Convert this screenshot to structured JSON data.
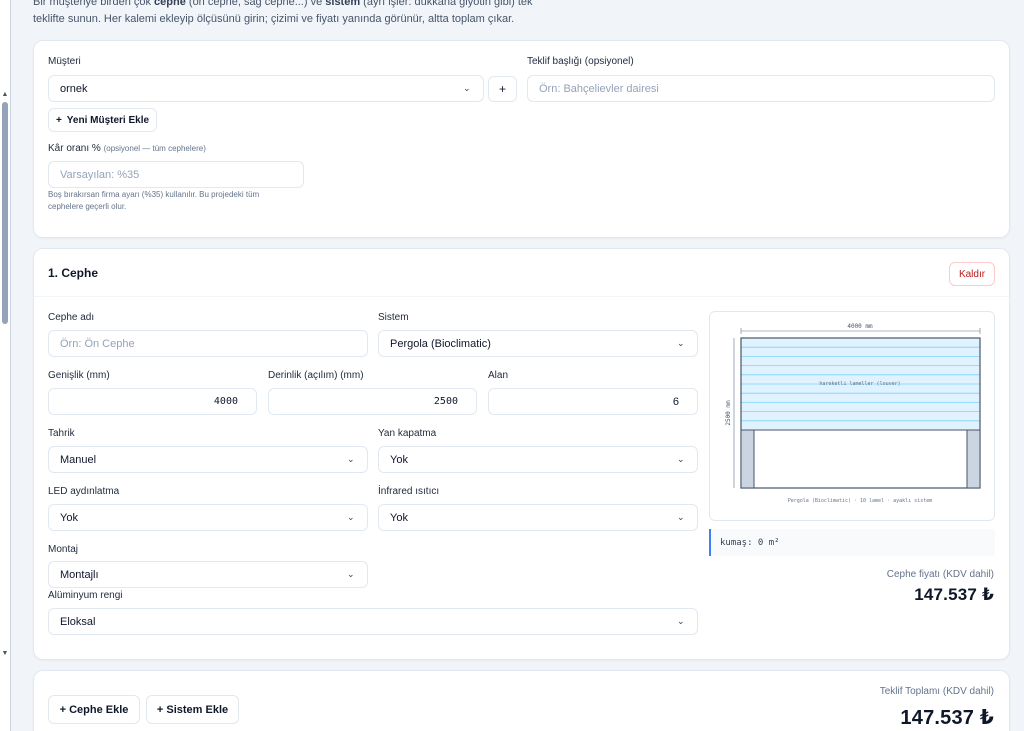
{
  "intro": {
    "line1_a": "Bir müşteriye birden çok ",
    "line1_b": "cephe",
    "line1_c": " (ön cephe, sağ cephe...) ve ",
    "line1_d": "sistem",
    "line1_e": " (ayrı işler: dükkana giyotin gibi) tek",
    "line2": "teklifte sunun. Her kalemi ekleyip ölçüsünü girin; çizimi ve fiyatı yanında görünür, altta toplam çıkar."
  },
  "customer": {
    "label": "Müşteri",
    "value": "ornek",
    "plus_label": "+",
    "new_customer_label": "Yeni Müşteri Ekle"
  },
  "offer_title": {
    "label": "Teklif başlığı (opsiyonel)",
    "placeholder": "Örn: Bahçelievler dairesi"
  },
  "margin": {
    "label": "Kâr oranı %",
    "label_hint": "(opsiyonel — tüm cephelere)",
    "placeholder": "Varsayılan: %35",
    "helper_1": "Boş bırakırsan firma ayarı (%35) kullanılır. Bu projedeki tüm",
    "helper_2": "cephelere geçerli olur."
  },
  "facade": {
    "title": "1. Cephe",
    "remove_label": "Kaldır",
    "name_label": "Cephe adı",
    "name_placeholder": "Örn: Ön Cephe",
    "system_label": "Sistem",
    "system_value": "Pergola (Bioclimatic)",
    "width_label": "Genişlik (mm)",
    "width_value": "4000",
    "depth_label": "Derinlik (açılım) (mm)",
    "depth_value": "2500",
    "area_label": "Alan",
    "area_value": "6",
    "drive_label": "Tahrik",
    "drive_value": "Manuel",
    "side_label": "Yan kapatma",
    "side_value": "Yok",
    "led_label": "LED aydınlatma",
    "led_value": "Yok",
    "heater_label": "İnfrared ısıtıcı",
    "heater_value": "Yok",
    "mount_label": "Montaj",
    "mount_value": "Montajlı",
    "color_label": "Alüminyum rengi",
    "color_value": "Eloksal",
    "drawing": {
      "width_dim": "4000 mm",
      "height_dim": "2500 mm",
      "center_text": "hareketli lameller (louver)",
      "caption": "Pergola (Bioclimatic) · 10 lamel · ayaklı sistem",
      "lamel_count": 10
    },
    "note": "kumaş: 0 m²",
    "price_label": "Cephe fiyatı (KDV dahil)",
    "price_value": "147.537 ₺"
  },
  "footer": {
    "add_facade_label": "+ Cephe Ekle",
    "add_system_label": "+ Sistem Ekle",
    "total_label": "Teklif Toplamı (KDV dahil)",
    "total_value": "147.537 ₺"
  },
  "colors": {
    "lamel": "#e0f2fe",
    "lamel_line": "#7dd3fc",
    "frame": "#475569",
    "post": "#cbd5e1",
    "accent": "#3b82f6"
  }
}
